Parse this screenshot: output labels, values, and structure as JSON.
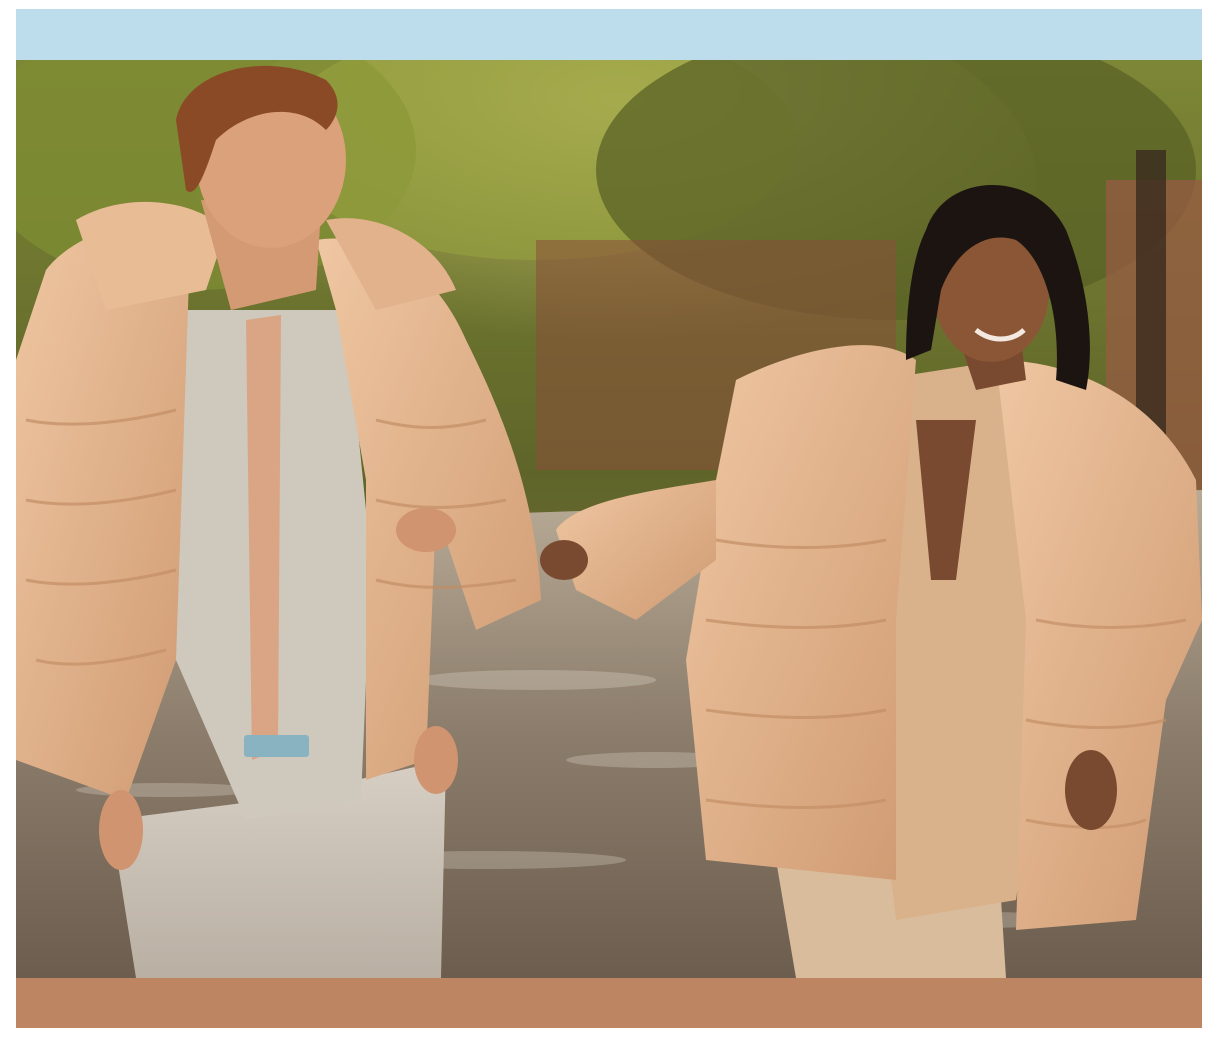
{
  "banner": {
    "top_band_color": "#bddcec",
    "bottom_band_color": "#bd8561"
  },
  "photo": {
    "subject": "two-models-walking-street-in-puffer-jackets",
    "palette": {
      "foliage": "#6f7a2c",
      "foliage_light": "#a9a84a",
      "street": "#8a7c6c",
      "jacket": "#e4b68f",
      "jacket_shadow": "#c9966f",
      "suit": "#d2cbc1",
      "skin_light": "#d8a07a",
      "skin_dark": "#7a4a30",
      "hair_red": "#8a4a26",
      "hair_dark": "#1c1410"
    }
  }
}
